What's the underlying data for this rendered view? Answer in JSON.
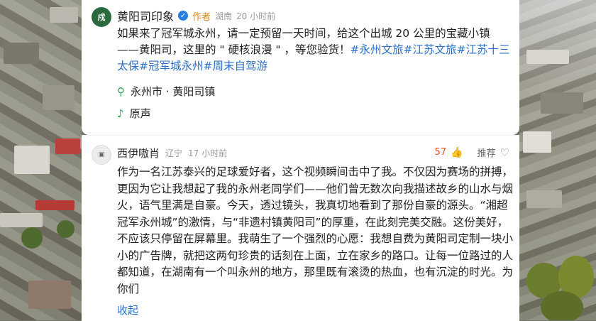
{
  "post": {
    "avatar_text": "戍",
    "author": "黄阳司印象",
    "author_tag": "作者",
    "region": "湖南",
    "time": "20 小时前",
    "text_plain": "如果来了冠军城永州，请一定预留一天时间，给这个出城 20 公里的宝藏小镇——黄阳司，这里的 \" 硬核浪漫 \" ，等您验货！",
    "hashtags": [
      "#永州文旅",
      "#江苏文旅",
      "#江苏十三太保",
      "#冠军城永州",
      "#周末自驾游"
    ],
    "location": "永州市 · 黄阳司镇",
    "sound": "原声",
    "icons": {
      "location": "location-pin-icon",
      "sound": "music-note-icon",
      "verified": "verified-badge-icon"
    }
  },
  "comment": {
    "author": "西伊嗷肖",
    "region": "辽宁",
    "time": "17 小时前",
    "likes": "57",
    "recommend_label": "推荐",
    "text": "作为一名江苏泰兴的足球爱好者，这个视频瞬间击中了我。不仅因为赛场的拼搏，更因为它让我想起了我的永州老同学们——他们曾无数次向我描述故乡的山水与烟火，语气里满是自豪。今天，透过镜头，我真切地看到了那份自豪的源头。“湘超冠军永州城”的激情，与“非遗村镇黄阳司”的厚重，在此刻完美交融。这份美好，不应该只停留在屏幕里。我萌生了一个强烈的心愿：我想自费为黄阳司定制一块小小的广告牌，就把这两句珍贵的话刻在上面，立在家乡的路口。让每一位路过的人都知道，在湖南有一个叫永州的地方，那里既有滚烫的热血，也有沉淀的时光。为你们",
    "collapse_label": "收起",
    "icons": {
      "like": "thumb-up-icon",
      "favorite": "heart-outline-icon"
    }
  },
  "colors": {
    "link": "#2a6fc9",
    "like": "#e0502a",
    "author_tag": "#e08a1e",
    "location_icon": "#3aa15a"
  }
}
